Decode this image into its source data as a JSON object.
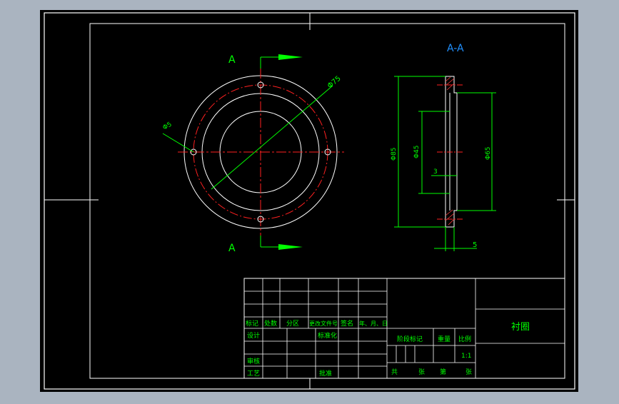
{
  "view": {
    "section_letter": "A",
    "section_title": "A-A"
  },
  "dimensions": {
    "front_diameter": "Φ75",
    "front_hole": "Φ5",
    "side_outer": "Φ85",
    "side_inner": "Φ45",
    "side_right": "Φ65",
    "side_step": "3",
    "side_thickness": "5"
  },
  "title_block": {
    "header": {
      "mark": "标记",
      "count": "处数",
      "zone": "分区",
      "change_doc": "更改文件号",
      "signature": "签名",
      "date": "年、月、日"
    },
    "design": "设计",
    "standardize": "标准化",
    "review": "审核",
    "process": "工艺",
    "approve": "批准",
    "stage_mark": "阶段标记",
    "weight": "重量",
    "scale_label": "比例",
    "scale_value": "1:1",
    "total": "共",
    "sheet": "张",
    "number": "第",
    "sheet2": "张",
    "part_name": "衬圈"
  },
  "colors": {
    "background": "#aab4c0",
    "paper": "#000000",
    "frame": "#ffffff",
    "dimension": "#00ff00",
    "center": "#ff2020",
    "section_title": "#2090ff",
    "hatch": "#ff4040"
  }
}
